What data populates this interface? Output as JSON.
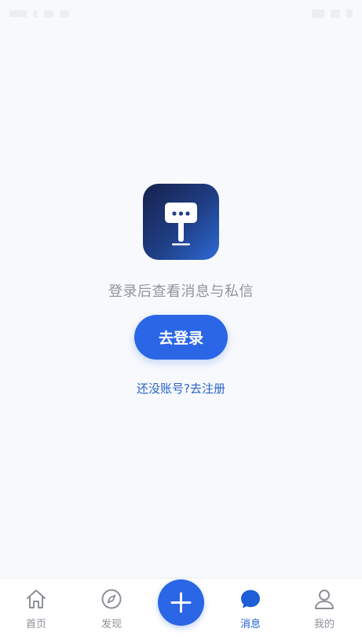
{
  "empty_state": {
    "message": "登录后查看消息与私信",
    "login_button": "去登录",
    "register_link": "还没账号?去注册"
  },
  "tab_bar": {
    "tabs": [
      {
        "label": "首页",
        "icon": "home-icon"
      },
      {
        "label": "发现",
        "icon": "compass-icon"
      },
      {
        "label": "消息",
        "icon": "message-bubble-icon",
        "active": true
      },
      {
        "label": "我的",
        "icon": "user-icon"
      }
    ],
    "center_button_icon": "plus-icon"
  },
  "colors": {
    "accent": "#2a66e6",
    "active_tab": "#1d5fd6",
    "inactive_tab": "#8c9099",
    "background": "#f7f9fc"
  }
}
